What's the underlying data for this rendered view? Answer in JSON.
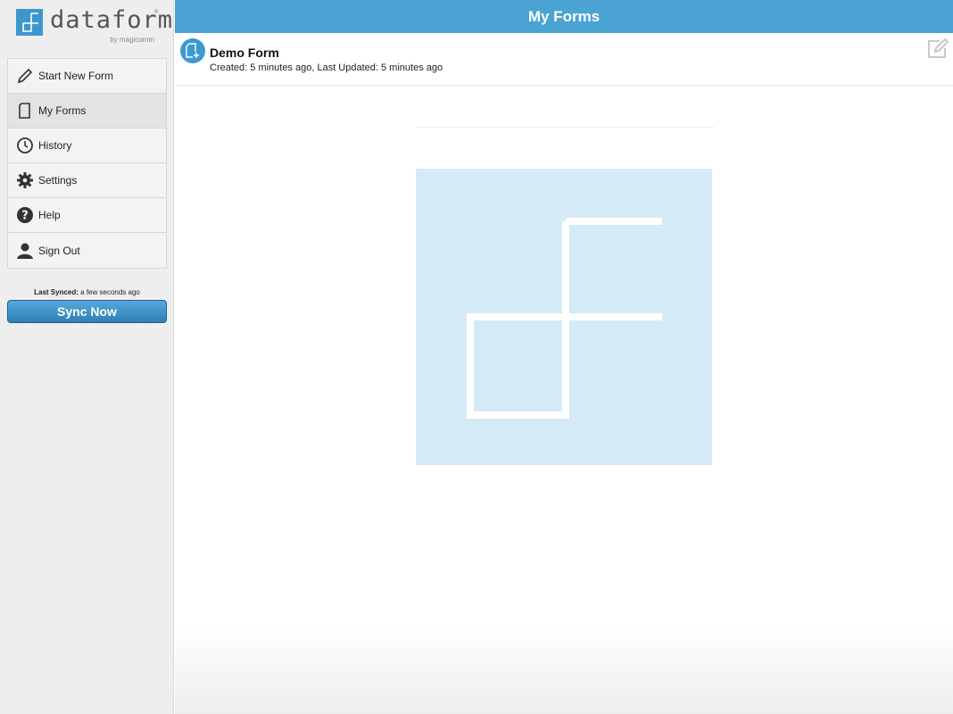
{
  "brand": {
    "name": "dataform",
    "registered": "®",
    "byline": "by magicomm",
    "accent": "#4aa3d3"
  },
  "sidebar": {
    "items": [
      {
        "label": "Start New Form",
        "icon": "pencil-icon"
      },
      {
        "label": "My Forms",
        "icon": "document-icon",
        "active": true
      },
      {
        "label": "History",
        "icon": "clock-icon"
      },
      {
        "label": "Settings",
        "icon": "gear-icon"
      },
      {
        "label": "Help",
        "icon": "question-icon"
      },
      {
        "label": "Sign Out",
        "icon": "user-icon"
      }
    ],
    "sync": {
      "status_label": "Last Synced:",
      "status_value": " a few seconds ago",
      "button_label": "Sync Now"
    }
  },
  "header": {
    "title": "My Forms"
  },
  "forms": [
    {
      "name": "Demo Form",
      "meta": "Created: 5 minutes ago, Last Updated: 5 minutes ago",
      "icon": "new-form-icon",
      "action_icon": "edit-icon"
    }
  ],
  "hero": {
    "icon": "dataform-logo-icon",
    "bg_color": "#d4eaf7"
  }
}
